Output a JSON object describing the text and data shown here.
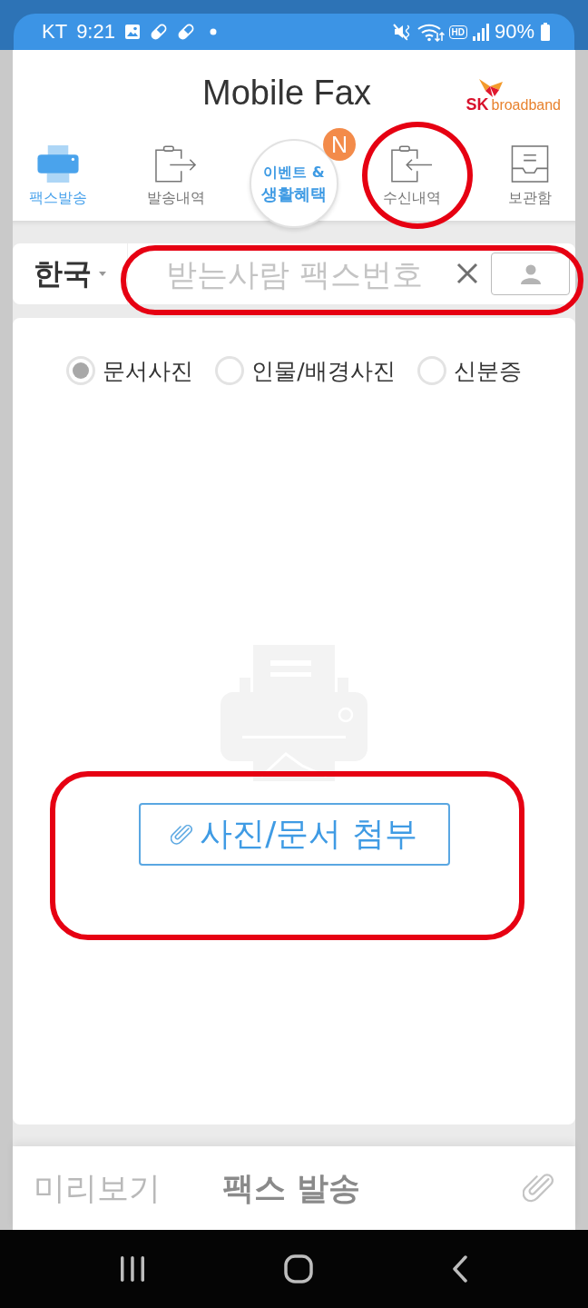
{
  "status_bar": {
    "carrier": "KT",
    "time": "9:21",
    "network_badge": "HD",
    "battery": "90%"
  },
  "header": {
    "title": "Mobile Fax",
    "logo": {
      "brand": "SK",
      "name": "broadband"
    }
  },
  "tabs": [
    {
      "kind": "tab",
      "label": "팩스발송",
      "selected": true,
      "highlighted": false
    },
    {
      "kind": "tab",
      "label": "발송내역",
      "selected": false,
      "highlighted": false
    },
    {
      "kind": "event",
      "lines": [
        "이벤트 &",
        "생활혜택"
      ],
      "badge": "N",
      "selected": false,
      "highlighted": false
    },
    {
      "kind": "tab",
      "label": "수신내역",
      "selected": false,
      "highlighted": true
    },
    {
      "kind": "tab",
      "label": "보관함",
      "selected": false,
      "highlighted": false
    }
  ],
  "recipient": {
    "country": "한국",
    "placeholder": "받는사람 팩스번호",
    "highlighted": true
  },
  "photo_types": [
    {
      "label": "문서사진",
      "selected": true
    },
    {
      "label": "인물/배경사진",
      "selected": false
    },
    {
      "label": "신분증",
      "selected": false
    }
  ],
  "attach": {
    "label": "사진/문서 첨부",
    "highlighted": true
  },
  "bottom_bar": {
    "preview": {
      "label": "미리보기",
      "disabled": true
    },
    "send": {
      "label": "팩스 발송",
      "disabled": false
    }
  }
}
